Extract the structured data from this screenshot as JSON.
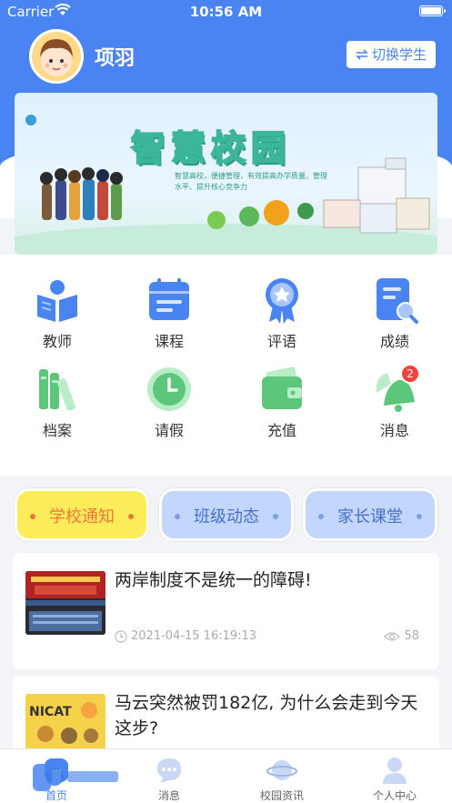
{
  "status_bar": {
    "carrier": "Carrier",
    "time": "10:56 AM"
  },
  "header": {
    "user_name": "项羽",
    "switch_student_label": "切换学生"
  },
  "banner": {
    "title": "智慧校园",
    "subtitle": "智慧高校，便捷管理，有效提高办学质量、管理水平、提升核心竞争力"
  },
  "grid": [
    {
      "label": "教师",
      "icon": "teacher-book-icon"
    },
    {
      "label": "课程",
      "icon": "calendar-icon"
    },
    {
      "label": "评语",
      "icon": "award-star-icon"
    },
    {
      "label": "成绩",
      "icon": "document-search-icon"
    },
    {
      "label": "档案",
      "icon": "books-icon"
    },
    {
      "label": "请假",
      "icon": "clock-icon"
    },
    {
      "label": "充值",
      "icon": "wallet-icon"
    },
    {
      "label": "消息",
      "icon": "bell-icon",
      "badge": "2"
    }
  ],
  "news_tabs": [
    {
      "label": "学校通知",
      "active": true
    },
    {
      "label": "班级动态",
      "active": false
    },
    {
      "label": "家长课堂",
      "active": false
    }
  ],
  "articles": [
    {
      "title": "两岸制度不是统一的障碍!",
      "date": "2021-04-15 16:19:13",
      "views": "58"
    },
    {
      "title": "马云突然被罚182亿, 为什么会走到今天这步?"
    }
  ],
  "tabbar": [
    {
      "label": "首页",
      "icon": "home-icon"
    },
    {
      "label": "消息",
      "icon": "chat-icon"
    },
    {
      "label": "校园资讯",
      "icon": "planet-icon"
    },
    {
      "label": "个人中心",
      "icon": "person-icon"
    }
  ],
  "colors": {
    "primary": "#4a84f2",
    "active_tab_bg": "#fcec5a",
    "active_tab_text": "#e8793a",
    "badge": "#f0443a"
  }
}
